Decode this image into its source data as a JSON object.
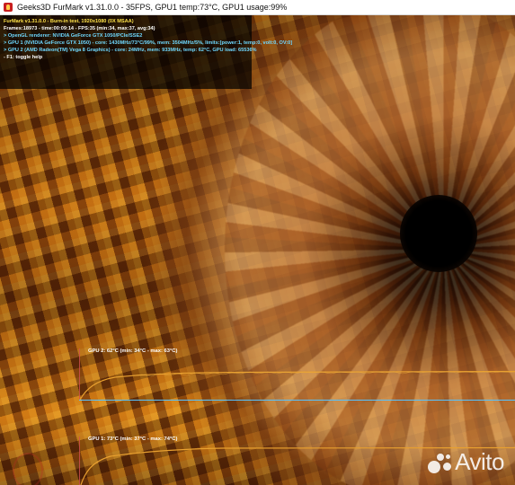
{
  "window": {
    "title": "Geeks3D FurMark v1.31.0.0 - 35FPS, GPU1 temp:73°C, GPU1 usage:99%"
  },
  "overlay": {
    "lines": [
      "FurMark v1.31.0.0 - Burn-in test, 1920x1080 (0X MSAA)",
      "Frames:18973 - time:00:09:14 - FPS:35 (min:34, max:37, avg:34)",
      "> OpenGL renderer: NVIDIA GeForce GTX 1050/PCIe/SSE2",
      "> GPU 1 (NVIDIA GeForce GTX 1050) - core: 1430MHz/73°C/99%, mem: 3504MHz/5%, limits:[power:1, temp:0, volt:0, OV:0]",
      "> GPU 2 (AMD Radeon(TM) Vega 8 Graphics) - core: 24MHz, mem: 933MHz, temp: 62°C, GPU load: 65536%",
      "- F1: toggle help"
    ],
    "colors": [
      "yellow",
      "white",
      "cyan",
      "cyan",
      "cyan",
      "white"
    ]
  },
  "graphs": [
    {
      "label": "GPU 2: 62°C (min: 34°C - max: 63°C)",
      "line_color": "#e8a030"
    },
    {
      "label": "GPU 1: 73°C (min: 37°C - max: 74°C)",
      "line_color": "#e8a030"
    }
  ],
  "watermark": {
    "text": "Avito"
  },
  "colors": {
    "overlay_yellow": "#ffe34a",
    "overlay_cyan": "#6fd8ff",
    "graph_frame": "#56c3ff",
    "graph_line": "#e8a030"
  }
}
